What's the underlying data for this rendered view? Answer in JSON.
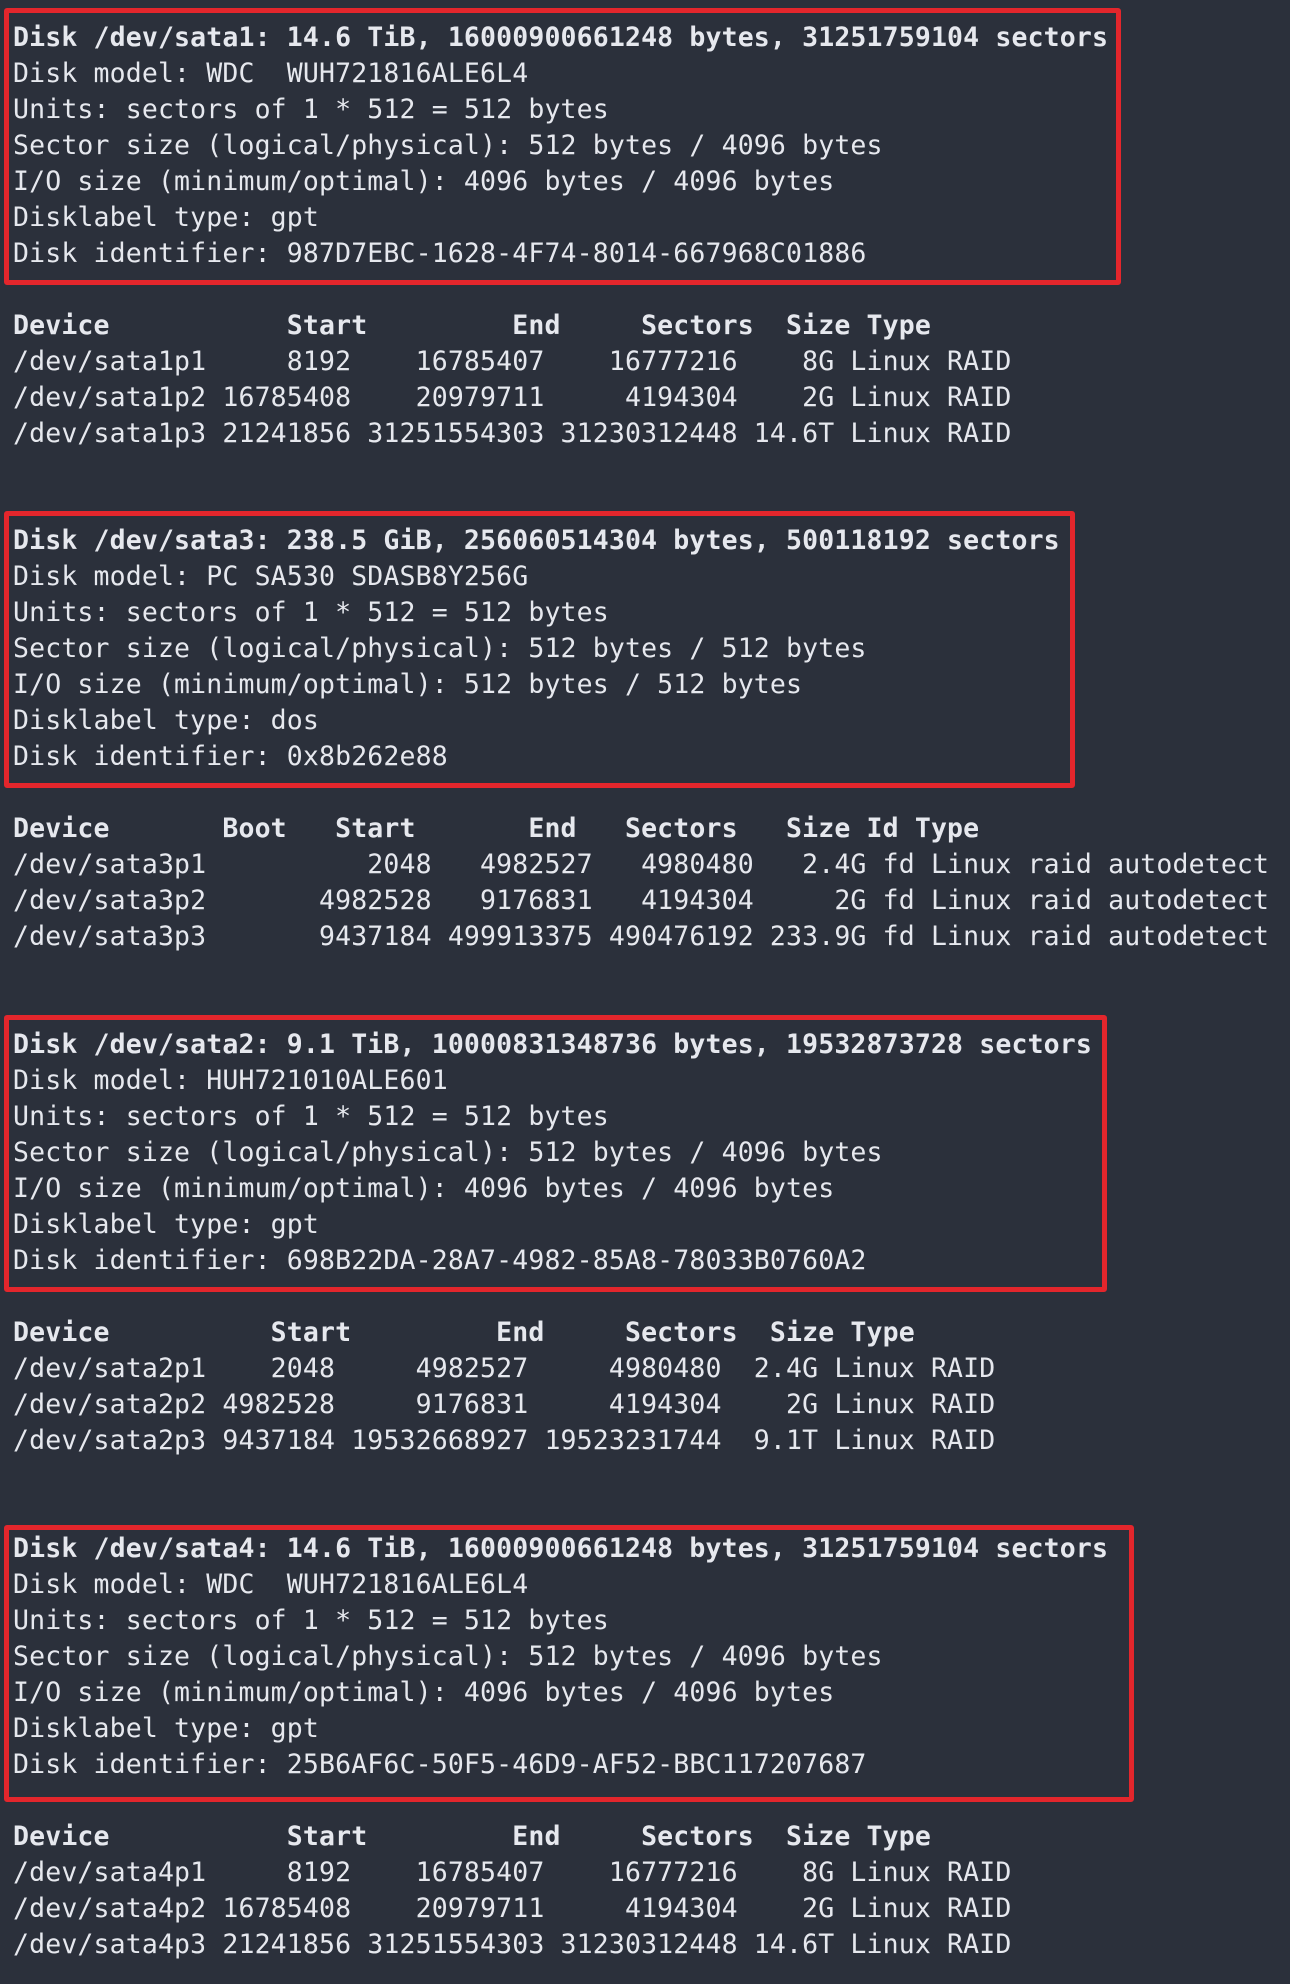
{
  "disks": [
    {
      "header": "Disk /dev/sata1: 14.6 TiB, 16000900661248 bytes, 31251759104 sectors",
      "info": [
        "Disk model: WDC  WUH721816ALE6L4",
        "Units: sectors of 1 * 512 = 512 bytes",
        "Sector size (logical/physical): 512 bytes / 4096 bytes",
        "I/O size (minimum/optimal): 4096 bytes / 4096 bytes",
        "Disklabel type: gpt",
        "Disk identifier: 987D7EBC-1628-4F74-8014-667968C01886"
      ],
      "table_header": "Device           Start         End     Sectors  Size Type",
      "rows": [
        "/dev/sata1p1     8192    16785407    16777216    8G Linux RAID",
        "/dev/sata1p2 16785408    20979711     4194304    2G Linux RAID",
        "/dev/sata1p3 21241856 31251554303 31230312448 14.6T Linux RAID"
      ]
    },
    {
      "header": "Disk /dev/sata3: 238.5 GiB, 256060514304 bytes, 500118192 sectors",
      "info": [
        "Disk model: PC SA530 SDASB8Y256G",
        "Units: sectors of 1 * 512 = 512 bytes",
        "Sector size (logical/physical): 512 bytes / 512 bytes",
        "I/O size (minimum/optimal): 512 bytes / 512 bytes",
        "Disklabel type: dos",
        "Disk identifier: 0x8b262e88"
      ],
      "table_header": "Device       Boot   Start       End   Sectors   Size Id Type",
      "rows": [
        "/dev/sata3p1          2048   4982527   4980480   2.4G fd Linux raid autodetect",
        "/dev/sata3p2       4982528   9176831   4194304     2G fd Linux raid autodetect",
        "/dev/sata3p3       9437184 499913375 490476192 233.9G fd Linux raid autodetect"
      ]
    },
    {
      "header": "Disk /dev/sata2: 9.1 TiB, 10000831348736 bytes, 19532873728 sectors",
      "info": [
        "Disk model: HUH721010ALE601",
        "Units: sectors of 1 * 512 = 512 bytes",
        "Sector size (logical/physical): 512 bytes / 4096 bytes",
        "I/O size (minimum/optimal): 4096 bytes / 4096 bytes",
        "Disklabel type: gpt",
        "Disk identifier: 698B22DA-28A7-4982-85A8-78033B0760A2"
      ],
      "table_header": "Device          Start         End     Sectors  Size Type",
      "rows": [
        "/dev/sata2p1    2048     4982527     4980480  2.4G Linux RAID",
        "/dev/sata2p2 4982528     9176831     4194304    2G Linux RAID",
        "/dev/sata2p3 9437184 19532668927 19523231744  9.1T Linux RAID"
      ]
    },
    {
      "header": "Disk /dev/sata4: 14.6 TiB, 16000900661248 bytes, 31251759104 sectors",
      "info": [
        "Disk model: WDC  WUH721816ALE6L4",
        "Units: sectors of 1 * 512 = 512 bytes",
        "Sector size (logical/physical): 512 bytes / 4096 bytes",
        "I/O size (minimum/optimal): 4096 bytes / 4096 bytes",
        "Disklabel type: gpt",
        "Disk identifier: 25B6AF6C-50F5-46D9-AF52-BBC117207687"
      ],
      "table_header": "Device           Start         End     Sectors  Size Type",
      "rows": [
        "/dev/sata4p1     8192    16785407    16777216    8G Linux RAID",
        "/dev/sata4p2 16785408    20979711     4194304    2G Linux RAID",
        "/dev/sata4p3 21241856 31251554303 31230312448 14.6T Linux RAID"
      ]
    }
  ],
  "colors": {
    "background": "#2b303b",
    "text": "#e6e8ee",
    "highlight_border": "#e3262c"
  }
}
